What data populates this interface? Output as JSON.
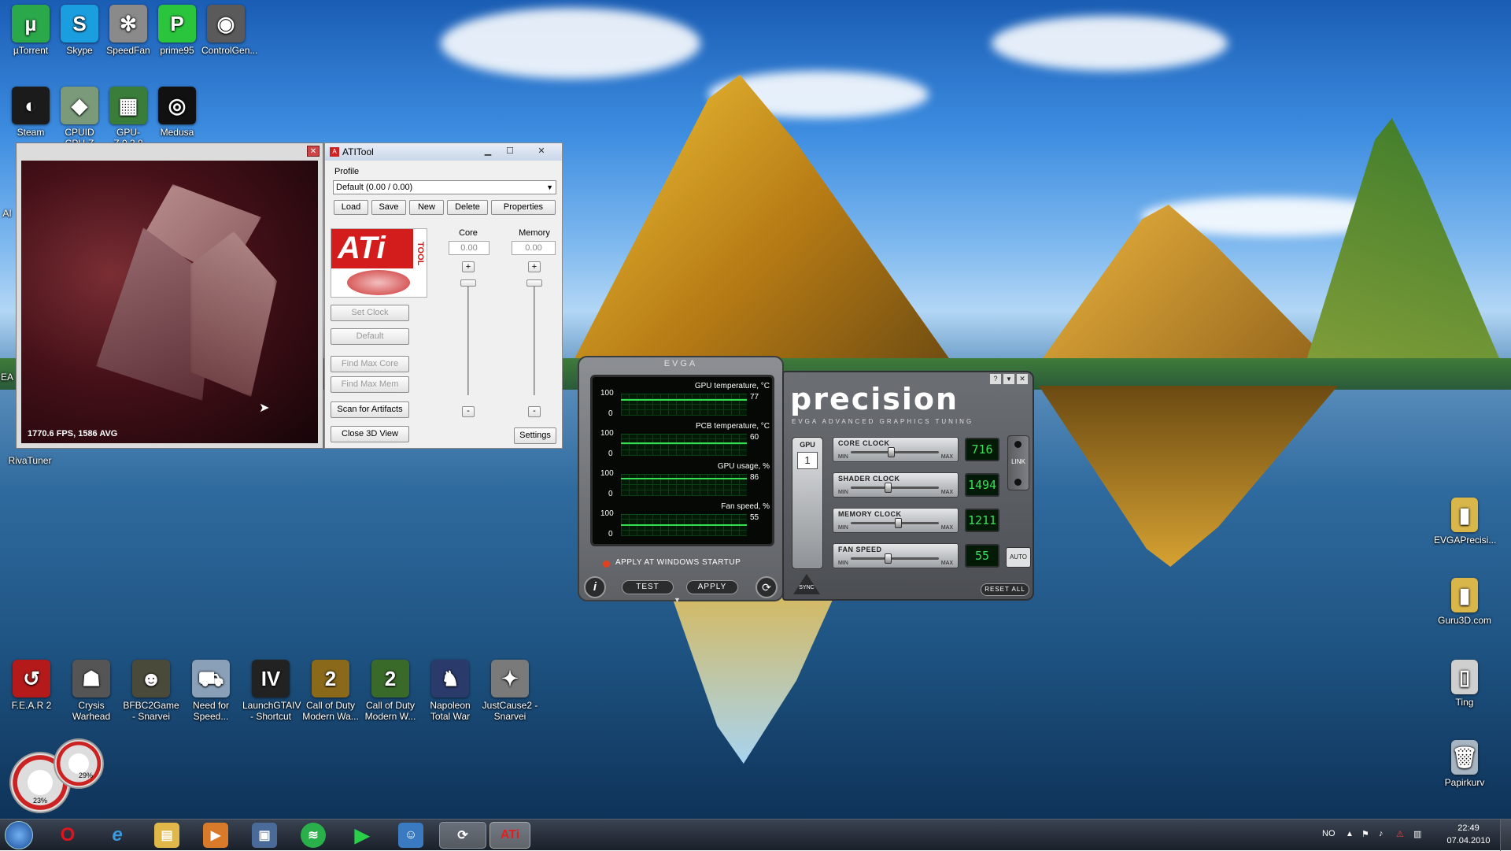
{
  "desktop": {
    "top_icons": [
      {
        "label": "µTorrent",
        "glyph": "µ",
        "color": "#2aa84a"
      },
      {
        "label": "Skype",
        "glyph": "S",
        "color": "#1a9ee0"
      },
      {
        "label": "SpeedFan",
        "glyph": "✻",
        "color": "#8a8a8a"
      },
      {
        "label": "prime95",
        "glyph": "P",
        "color": "#2ac53c"
      },
      {
        "label": "ControlGen...",
        "glyph": "◉",
        "color": "#5a5a5a"
      },
      {
        "label": "Steam",
        "glyph": "◐",
        "color": "#1b1b1b"
      },
      {
        "label": "CPUID CPU-Z",
        "glyph": "◆",
        "color": "#7a9a7a"
      },
      {
        "label": "GPU-Z.0.3.8",
        "glyph": "▦",
        "color": "#3a7d3a"
      },
      {
        "label": "Medusa",
        "glyph": "◎",
        "color": "#111111"
      }
    ],
    "left_edge_labels": [
      "AI",
      "EA"
    ],
    "rivatuner_label": "RivaTuner",
    "bottom_icons": [
      {
        "label": "F.E.A.R 2",
        "glyph": "↺",
        "color": "#b51a1a"
      },
      {
        "label": "Crysis Warhead",
        "glyph": "☗",
        "color": "#555555"
      },
      {
        "label": "BFBC2Game - Snarvei",
        "glyph": "☻",
        "color": "#4a4a3a"
      },
      {
        "label": "Need for Speed...",
        "glyph": "⛟",
        "color": "#8aa0b8"
      },
      {
        "label": "LaunchGTAIV - Shortcut",
        "glyph": "IV",
        "color": "#222222"
      },
      {
        "label": "Call of Duty Modern Wa...",
        "glyph": "2",
        "color": "#8a6a1a"
      },
      {
        "label": "Call of Duty Modern W...",
        "glyph": "2",
        "color": "#3a6a2a"
      },
      {
        "label": "Napoleon Total War",
        "glyph": "♞",
        "color": "#2a3a6a"
      },
      {
        "label": "JustCause2 - Snarvei",
        "glyph": "✦",
        "color": "#7a7a7a"
      }
    ],
    "right_icons": [
      {
        "label": "EVGAPrecisi...",
        "glyph": "▮",
        "color": "#d9b64a"
      },
      {
        "label": "Guru3D.com",
        "glyph": "▮",
        "color": "#d9b64a"
      },
      {
        "label": "Ting",
        "glyph": "▯",
        "color": "#cfcfcf"
      },
      {
        "label": "Papirkurv",
        "glyph": "🗑",
        "color": "#a7b4c2"
      }
    ],
    "gadget_values": [
      "23%",
      "29%"
    ]
  },
  "view3d": {
    "fps_text": "1770.6 FPS, 1586 AVG"
  },
  "atitool": {
    "title": "ATITool",
    "profile_label": "Profile",
    "profile_value": "Default (0.00 / 0.00)",
    "profile_buttons": [
      "Load",
      "Save",
      "New",
      "Delete",
      "Properties"
    ],
    "logo_text": "ATi",
    "logo_sub": "TOOL",
    "core_label": "Core",
    "memory_label": "Memory",
    "core_value": "0.00",
    "memory_value": "0.00",
    "action_buttons": [
      "Set Clock",
      "Default",
      "Find Max Core",
      "Find Max Mem",
      "Scan for Artifacts",
      "Close 3D View"
    ],
    "settings_label": "Settings"
  },
  "evga_monitor": {
    "brand": "EVGA",
    "graphs": [
      {
        "title": "GPU temperature, °C",
        "max": "100",
        "min": "0",
        "value": "77"
      },
      {
        "title": "PCB temperature, °C",
        "max": "100",
        "min": "0",
        "value": "60"
      },
      {
        "title": "GPU usage, %",
        "max": "100",
        "min": "0",
        "value": "86"
      },
      {
        "title": "Fan speed, %",
        "max": "100",
        "min": "0",
        "value": "55"
      }
    ],
    "startup_label": "APPLY AT WINDOWS STARTUP",
    "test_label": "TEST",
    "apply_label": "APPLY"
  },
  "precision": {
    "logo": "precision",
    "subtitle": "EVGA ADVANCED GRAPHICS TUNING",
    "gpu_label": "GPU",
    "gpu_number": "1",
    "link_label": "LINK",
    "auto_label": "AUTO",
    "sync_label": "SYNC",
    "reset_label": "RESET ALL",
    "min_label": "MIN",
    "max_label": "MAX",
    "rows": [
      {
        "label": "CORE CLOCK",
        "value": "716",
        "level": 0.42
      },
      {
        "label": "SHADER CLOCK",
        "value": "1494",
        "level": 0.38
      },
      {
        "label": "MEMORY CLOCK",
        "value": "1211",
        "level": 0.5
      },
      {
        "label": "FAN SPEED",
        "value": "55",
        "level": 0.38
      }
    ]
  },
  "taskbar": {
    "language": "NO",
    "time": "22:49",
    "date": "07.04.2010"
  }
}
